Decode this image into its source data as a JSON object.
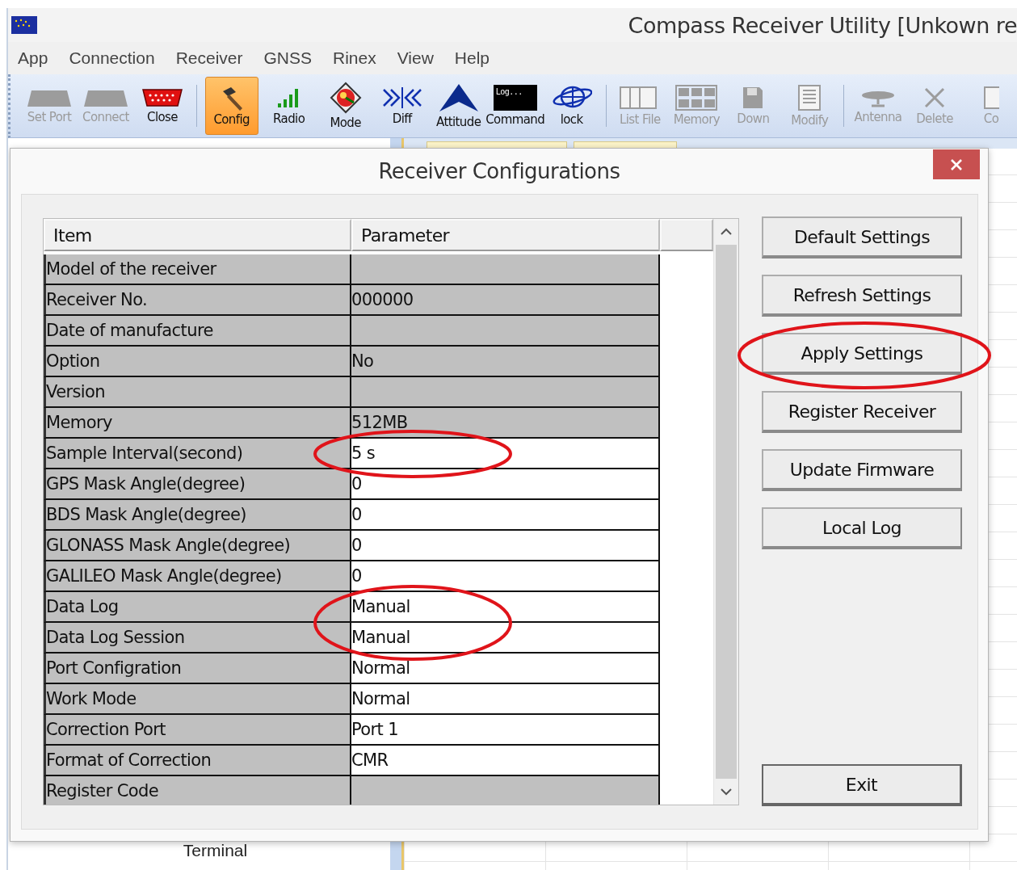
{
  "window": {
    "title": "Compass Receiver Utility [Unkown re"
  },
  "menu": [
    {
      "label": "App"
    },
    {
      "label": "Connection"
    },
    {
      "label": "Receiver"
    },
    {
      "label": "GNSS"
    },
    {
      "label": "Rinex"
    },
    {
      "label": "View"
    },
    {
      "label": "Help"
    }
  ],
  "toolbar": {
    "groups": [
      {
        "tools": [
          {
            "label": "Set Port",
            "disabled": true,
            "selected": false
          },
          {
            "label": "Connect",
            "disabled": true,
            "selected": false
          },
          {
            "label": "Close",
            "disabled": false,
            "selected": false
          }
        ]
      },
      {
        "tools": [
          {
            "label": "Config",
            "disabled": false,
            "selected": true
          },
          {
            "label": "Radio",
            "disabled": false,
            "selected": false
          },
          {
            "label": "Mode",
            "disabled": false,
            "selected": false
          },
          {
            "label": "Diff",
            "disabled": false,
            "selected": false
          },
          {
            "label": "Attitude",
            "disabled": false,
            "selected": false
          },
          {
            "label": "Command",
            "disabled": false,
            "selected": false,
            "screen_text": "Log..."
          },
          {
            "label": "lock",
            "disabled": false,
            "selected": false
          }
        ]
      },
      {
        "tools": [
          {
            "label": "List File",
            "disabled": true,
            "selected": false
          },
          {
            "label": "Memory",
            "disabled": true,
            "selected": false
          },
          {
            "label": "Down",
            "disabled": true,
            "selected": false
          },
          {
            "label": "Modify",
            "disabled": true,
            "selected": false
          }
        ]
      },
      {
        "tools": [
          {
            "label": "Antenna",
            "disabled": true,
            "selected": false
          },
          {
            "label": "Delete",
            "disabled": true,
            "selected": false
          },
          {
            "label": "Co",
            "disabled": true,
            "selected": false
          }
        ]
      }
    ]
  },
  "workspace": {
    "left_panel": {
      "label": "Terminal"
    }
  },
  "dialog": {
    "title": "Receiver Configurations",
    "table": {
      "columns": [
        "Item",
        "Parameter"
      ],
      "rows": [
        {
          "item": "Model of the receiver",
          "editable": false,
          "circled": false
        },
        {
          "item": "Receiver No.",
          "parameter": "000000",
          "editable": false,
          "circled": false
        },
        {
          "item": "Date of manufacture",
          "editable": false,
          "circled": false
        },
        {
          "item": "Option",
          "parameter": "No",
          "editable": false,
          "circled": false
        },
        {
          "item": "Version",
          "editable": false,
          "circled": false
        },
        {
          "item": "Memory",
          "parameter": "512MB",
          "editable": false,
          "circled": false
        },
        {
          "item": "Sample Interval(second)",
          "parameter": "5 s",
          "editable": true,
          "circled": true
        },
        {
          "item": "GPS Mask Angle(degree)",
          "parameter": "0",
          "editable": true,
          "circled": false
        },
        {
          "item": "BDS Mask Angle(degree)",
          "parameter": "0",
          "editable": true,
          "circled": false
        },
        {
          "item": "GLONASS Mask Angle(degree)",
          "parameter": "0",
          "editable": true,
          "circled": false
        },
        {
          "item": "GALILEO Mask Angle(degree)",
          "parameter": "0",
          "editable": true,
          "circled": false
        },
        {
          "item": "Data Log",
          "parameter": "Manual",
          "editable": true,
          "circled": true
        },
        {
          "item": "Data Log Session",
          "parameter": "Manual",
          "editable": true,
          "circled": true
        },
        {
          "item": "Port Configration",
          "parameter": "Normal",
          "editable": true,
          "circled": false
        },
        {
          "item": "Work Mode",
          "parameter": "Normal",
          "editable": true,
          "circled": false
        },
        {
          "item": "Correction Port",
          "parameter": "Port 1",
          "editable": true,
          "circled": false
        },
        {
          "item": "Format of Correction",
          "parameter": "CMR",
          "editable": true,
          "circled": false
        },
        {
          "item": "Register Code",
          "editable": false,
          "circled": false
        }
      ]
    },
    "buttons": [
      {
        "label": "Default Settings",
        "kind": "action",
        "circled": false
      },
      {
        "label": "Refresh Settings",
        "kind": "action",
        "circled": false
      },
      {
        "label": "Apply Settings",
        "kind": "action",
        "circled": true
      },
      {
        "label": "Register Receiver",
        "kind": "action",
        "circled": false
      },
      {
        "label": "Update Firmware",
        "kind": "action",
        "circled": false
      },
      {
        "label": "Local Log",
        "kind": "action",
        "circled": false
      },
      {
        "label": "Exit",
        "kind": "exit",
        "circled": false
      }
    ]
  }
}
